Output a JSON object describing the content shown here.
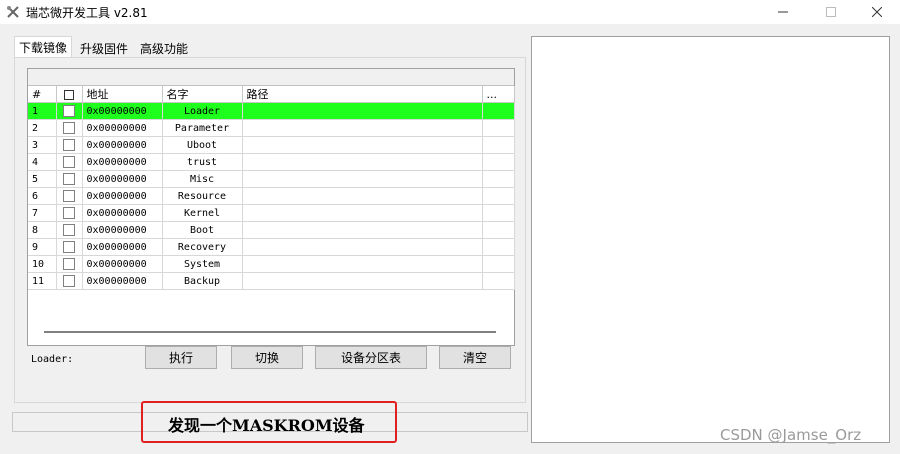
{
  "window": {
    "title": "瑞芯微开发工具 v2.81",
    "minimize_icon": "minimize-icon",
    "maximize_icon": "maximize-icon",
    "close_icon": "close-icon"
  },
  "tabs": [
    {
      "label": "下载镜像",
      "active": true
    },
    {
      "label": "升级固件",
      "active": false
    },
    {
      "label": "高级功能",
      "active": false
    }
  ],
  "table": {
    "columns": [
      "#",
      "",
      "地址",
      "名字",
      "路径",
      "..."
    ],
    "rows": [
      {
        "num": "1",
        "address": "0x00000000",
        "name": "Loader",
        "path": "",
        "selected": true
      },
      {
        "num": "2",
        "address": "0x00000000",
        "name": "Parameter",
        "path": "",
        "selected": false
      },
      {
        "num": "3",
        "address": "0x00000000",
        "name": "Uboot",
        "path": "",
        "selected": false
      },
      {
        "num": "4",
        "address": "0x00000000",
        "name": "trust",
        "path": "",
        "selected": false
      },
      {
        "num": "5",
        "address": "0x00000000",
        "name": "Misc",
        "path": "",
        "selected": false
      },
      {
        "num": "6",
        "address": "0x00000000",
        "name": "Resource",
        "path": "",
        "selected": false
      },
      {
        "num": "7",
        "address": "0x00000000",
        "name": "Kernel",
        "path": "",
        "selected": false
      },
      {
        "num": "8",
        "address": "0x00000000",
        "name": "Boot",
        "path": "",
        "selected": false
      },
      {
        "num": "9",
        "address": "0x00000000",
        "name": "Recovery",
        "path": "",
        "selected": false
      },
      {
        "num": "10",
        "address": "0x00000000",
        "name": "System",
        "path": "",
        "selected": false
      },
      {
        "num": "11",
        "address": "0x00000000",
        "name": "Backup",
        "path": "",
        "selected": false
      }
    ],
    "selected_color": "#1eff1e"
  },
  "loader_label": "Loader:",
  "buttons": {
    "execute": "执行",
    "switch": "切换",
    "partition_table": "设备分区表",
    "clear": "清空"
  },
  "status": {
    "message": "发现一个MASKROM设备",
    "highlight_color": "#e02020"
  },
  "watermark": "CSDN @Jamse_Orz"
}
